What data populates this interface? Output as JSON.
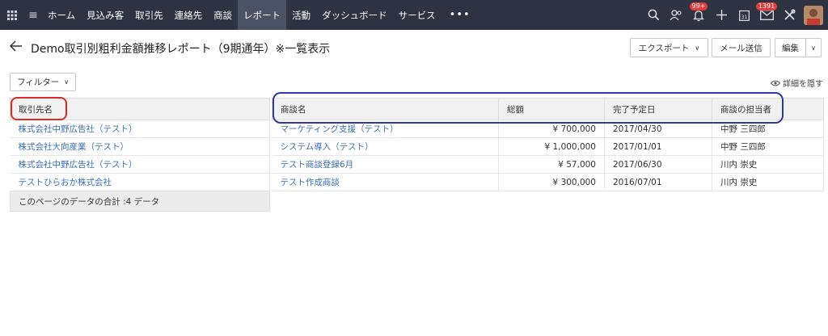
{
  "nav": {
    "items": [
      "ホーム",
      "見込み客",
      "取引先",
      "連絡先",
      "商談",
      "レポート",
      "活動",
      "ダッシュボード",
      "サービス"
    ],
    "active": "レポート",
    "more": "•••",
    "notifications_badge": "99+",
    "mail_badge": "1391"
  },
  "page": {
    "title": "Demo取引別粗利金額推移レポート（9期通年）※一覧表示",
    "export_label": "エクスポート",
    "send_mail_label": "メール送信",
    "edit_label": "編集",
    "filter_label": "フィルター",
    "hide_details_label": "詳細を隠す"
  },
  "left_table": {
    "header": "取引先名",
    "rows": [
      "株式会社中野広告社（テスト）",
      "株式会社大向産業（テスト）",
      "株式会社中野広告社（テスト）",
      "テストひらおか株式会社"
    ],
    "footer": "このページのデータの合計 :4 データ"
  },
  "right_table": {
    "headers": [
      "商談名",
      "総額",
      "完了予定日",
      "商談の担当者"
    ],
    "rows": [
      [
        "マーケティング支援（テスト）",
        "¥ 700,000",
        "2017/04/30",
        "中野 三四郎"
      ],
      [
        "システム導入（テスト）",
        "¥ 1,000,000",
        "2017/01/01",
        "中野 三四郎"
      ],
      [
        "テスト商談登録6月",
        "¥ 57,000",
        "2017/06/30",
        "川内 崇史"
      ],
      [
        "テスト作成商談",
        "¥ 300,000",
        "2016/07/01",
        "川内 崇史"
      ]
    ]
  },
  "colors": {
    "topbar": "#2d3340",
    "link": "#3b6fb6",
    "annotation_red": "#d92b2b",
    "annotation_blue": "#3038a8"
  },
  "icons": [
    "app-grid-icon",
    "menu-icon",
    "search-icon",
    "contacts-icon",
    "bell-icon",
    "plus-icon",
    "calendar-icon",
    "mail-icon",
    "tools-icon",
    "eye-icon",
    "back-arrow-icon"
  ]
}
